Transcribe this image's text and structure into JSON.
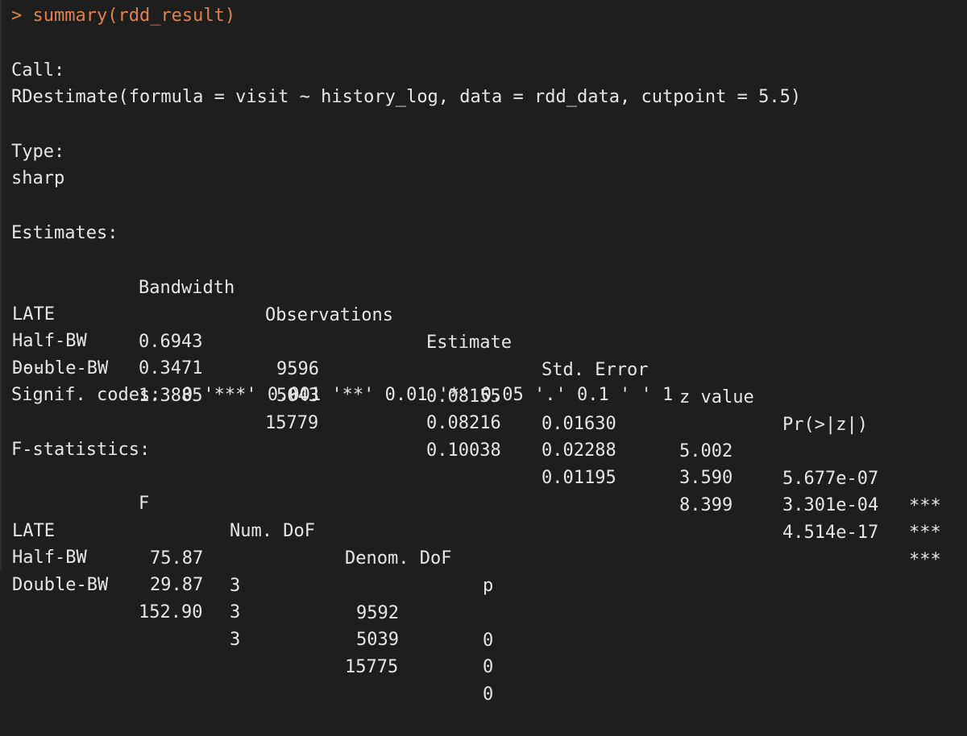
{
  "console": {
    "prompt_symbol": ">",
    "command": "summary(rdd_result)",
    "call_header": "Call:",
    "call_text": "RDestimate(formula = visit ~ history_log, data = rdd_data, cutpoint = 5.5)",
    "type_header": "Type:",
    "type_value": "sharp",
    "estimates_header": "Estimates:",
    "estimates": {
      "columns": [
        "Bandwidth",
        "Observations",
        "Estimate",
        "Std. Error",
        "z value",
        "Pr(>|z|)"
      ],
      "rows": [
        {
          "label": "LATE",
          "bandwidth": "0.6943",
          "observations": "9596",
          "estimate": "0.08155",
          "std_error": "0.01630",
          "z_value": "5.002",
          "p": "5.677e-07",
          "signif": "***"
        },
        {
          "label": "Half-BW",
          "bandwidth": "0.3471",
          "observations": "5043",
          "estimate": "0.08216",
          "std_error": "0.02288",
          "z_value": "3.590",
          "p": "3.301e-04",
          "signif": "***"
        },
        {
          "label": "Double-BW",
          "bandwidth": "1.3885",
          "observations": "15779",
          "estimate": "0.10038",
          "std_error": "0.01195",
          "z_value": "8.399",
          "p": "4.514e-17",
          "signif": "***"
        }
      ]
    },
    "separator": "---",
    "signif_codes": "Signif. codes:  0 '***' 0.001 '**' 0.01 '*' 0.05 '.' 0.1 ' ' 1",
    "fstat_header": "F-statistics:",
    "fstats": {
      "columns": [
        "F",
        "Num. DoF",
        "Denom. DoF",
        "p"
      ],
      "rows": [
        {
          "label": "LATE",
          "f": "75.87",
          "num_dof": "3",
          "denom_dof": "9592",
          "p": "0"
        },
        {
          "label": "Half-BW",
          "f": "29.87",
          "num_dof": "3",
          "denom_dof": "5039",
          "p": "0"
        },
        {
          "label": "Double-BW",
          "f": "152.90",
          "num_dof": "3",
          "denom_dof": "15775",
          "p": "0"
        }
      ]
    }
  }
}
